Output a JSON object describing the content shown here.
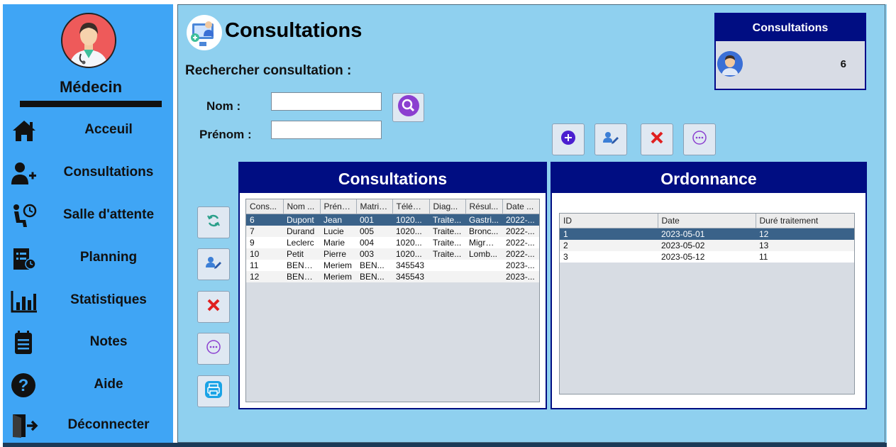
{
  "sidebar": {
    "role": "Médecin",
    "items": [
      {
        "label": "Acceuil",
        "icon": "home-icon"
      },
      {
        "label": "Consultations",
        "icon": "add-user-icon"
      },
      {
        "label": "Salle d'attente",
        "icon": "waiting-room-icon"
      },
      {
        "label": "Planning",
        "icon": "planning-icon"
      },
      {
        "label": "Statistiques",
        "icon": "bar-chart-icon"
      },
      {
        "label": "Notes",
        "icon": "notes-icon"
      },
      {
        "label": "Aide",
        "icon": "help-icon"
      },
      {
        "label": "Déconnecter",
        "icon": "logout-icon"
      }
    ]
  },
  "header": {
    "title": "Consultations",
    "search_title": "Rechercher consultation :"
  },
  "search": {
    "nom_label": "Nom :",
    "prenom_label": "Prénom :",
    "nom_value": "",
    "prenom_value": ""
  },
  "count_card": {
    "title": "Consultations",
    "value": "6"
  },
  "consultations": {
    "title": "Consultations",
    "columns": [
      "Cons...",
      "Nom ...",
      "Préno...",
      "Matric...",
      "Téléph...",
      "Diag...",
      "Résul...",
      "Date ..."
    ],
    "rows": [
      [
        "6",
        "Dupont",
        "Jean",
        "001",
        "1020...",
        "Traite...",
        "Gastri...",
        "2022-..."
      ],
      [
        "7",
        "Durand",
        "Lucie",
        "005",
        "1020...",
        "Traite...",
        "Bronc...",
        "2022-..."
      ],
      [
        "9",
        "Leclerc",
        "Marie",
        "004",
        "1020...",
        "Traite...",
        "Migrai...",
        "2022-..."
      ],
      [
        "10",
        "Petit",
        "Pierre",
        "003",
        "1020...",
        "Traite...",
        "Lomb...",
        "2022-..."
      ],
      [
        "11",
        "BENA...",
        "Meriem",
        "BEN...",
        "345543",
        "",
        "",
        "2023-..."
      ],
      [
        "12",
        "BENA...",
        "Meriem",
        "BEN...",
        "345543",
        "",
        "",
        "2023-..."
      ]
    ],
    "selected_row": 0
  },
  "ordonnance": {
    "title": "Ordonnance",
    "columns": [
      "ID",
      "Date",
      "Duré traitement"
    ],
    "rows": [
      [
        "1",
        "2023-05-01",
        "12"
      ],
      [
        "2",
        "2023-05-02",
        "13"
      ],
      [
        "3",
        "2023-05-12",
        "11"
      ]
    ],
    "selected_row": 0
  },
  "colors": {
    "sidebar": "#3fa5f5",
    "main_bg": "#8fd0ef",
    "panel_header": "#000d82",
    "selected_row": "#3a6289",
    "avatar_bg": "#ee5a5a"
  }
}
